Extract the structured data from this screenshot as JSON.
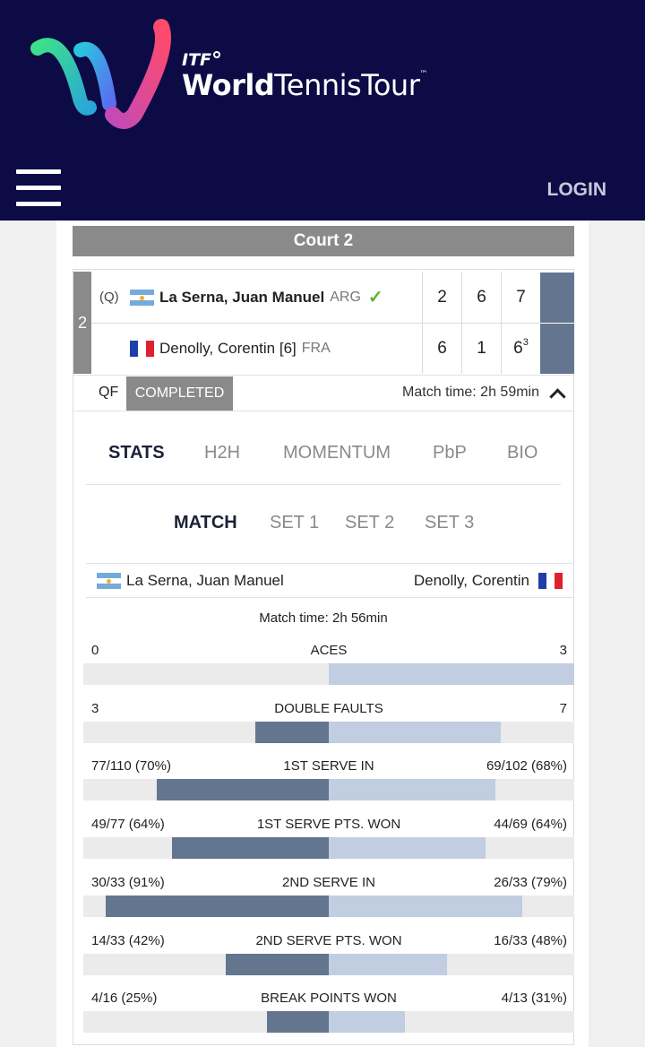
{
  "header": {
    "brand_itf": "ITF",
    "brand_name_bold": "World",
    "brand_name_rest": "TennisTour",
    "brand_tm": "™",
    "login": "LOGIN",
    "menu_icon": "hamburger-icon",
    "logo_icon": "world-tennis-tour-logo"
  },
  "court": "Court 2",
  "match": {
    "seed_number": "2",
    "players": [
      {
        "qualifier": "(Q)",
        "flag_icon": "argentina-flag-icon",
        "name": "La Serna, Juan Manuel",
        "nation": "ARG",
        "winner": "✓",
        "scores": [
          "2",
          "6",
          "7"
        ],
        "tiebreak": ""
      },
      {
        "qualifier": "",
        "flag_icon": "france-flag-icon",
        "name": "Denolly, Corentin [6]",
        "nation": "FRA",
        "winner": "",
        "scores": [
          "6",
          "1",
          "6"
        ],
        "tiebreak": "3"
      }
    ],
    "round": "QF",
    "status": "COMPLETED",
    "match_time": "Match time: 2h 59min"
  },
  "tabs": [
    "STATS",
    "H2H",
    "MOMENTUM",
    "PbP",
    "BIO"
  ],
  "active_tab": "STATS",
  "subtabs": [
    "MATCH",
    "SET 1",
    "SET 2",
    "SET 3"
  ],
  "active_subtab": "MATCH",
  "stats_players": {
    "left": "La Serna, Juan Manuel",
    "right": "Denolly, Corentin"
  },
  "stats_match_time": "Match time: 2h 56min",
  "colors": {
    "header_bg": "#0c0b45",
    "left_bar": "#647590",
    "right_bar": "#c1cde0",
    "track": "#ebebeb",
    "winner_check": "#5cb531"
  },
  "stats": [
    {
      "label": "ACES",
      "left": "0",
      "right": "3",
      "left_ratio": 0.0,
      "right_ratio": 1.0
    },
    {
      "label": "DOUBLE FAULTS",
      "left": "3",
      "right": "7",
      "left_ratio": 0.3,
      "right_ratio": 0.7
    },
    {
      "label": "1ST SERVE IN",
      "left": "77/110 (70%)",
      "right": "69/102 (68%)",
      "left_ratio": 0.7,
      "right_ratio": 0.68
    },
    {
      "label": "1ST SERVE PTS. WON",
      "left": "49/77 (64%)",
      "right": "44/69 (64%)",
      "left_ratio": 0.64,
      "right_ratio": 0.64
    },
    {
      "label": "2ND SERVE IN",
      "left": "30/33 (91%)",
      "right": "26/33 (79%)",
      "left_ratio": 0.91,
      "right_ratio": 0.79
    },
    {
      "label": "2ND SERVE PTS. WON",
      "left": "14/33 (42%)",
      "right": "16/33 (48%)",
      "left_ratio": 0.42,
      "right_ratio": 0.48
    },
    {
      "label": "BREAK POINTS WON",
      "left": "4/16 (25%)",
      "right": "4/13 (31%)",
      "left_ratio": 0.25,
      "right_ratio": 0.31
    }
  ]
}
